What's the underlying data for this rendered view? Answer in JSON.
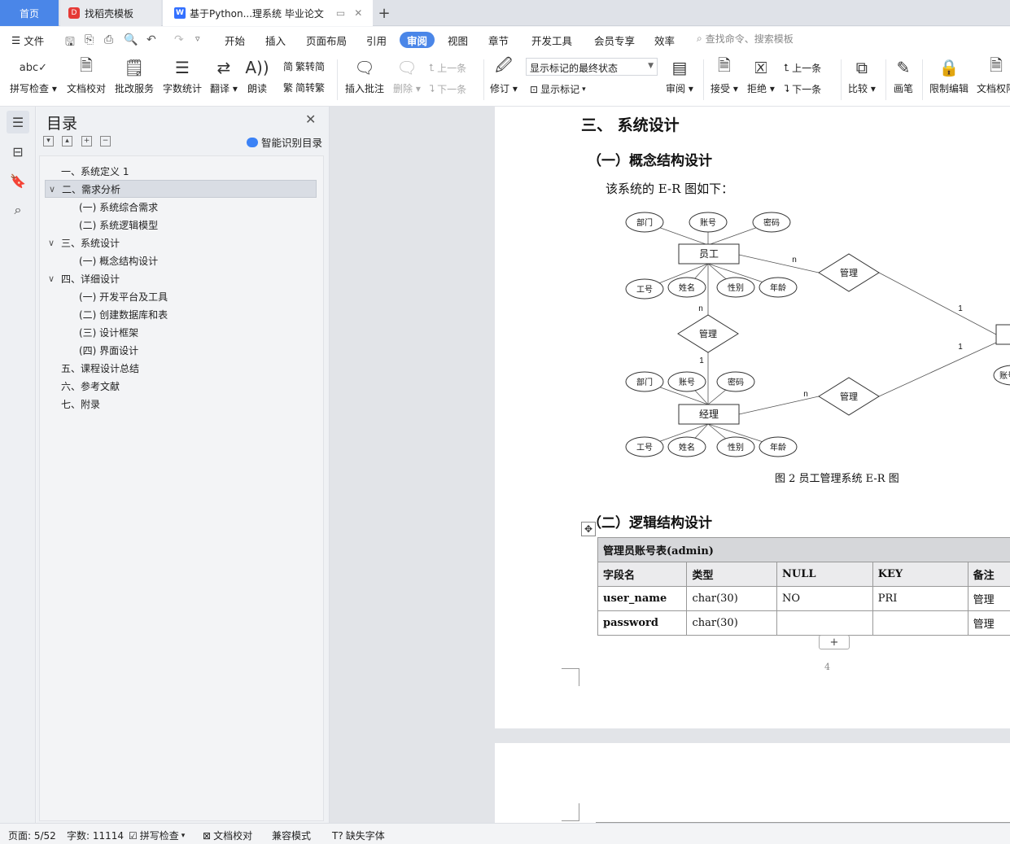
{
  "tabs": {
    "home": "首页",
    "templates": "找稻壳模板",
    "document": "基于Python...理系统 毕业论文",
    "new_tab": "+"
  },
  "menu": {
    "file": "文件",
    "items": [
      "开始",
      "插入",
      "页面布局",
      "引用",
      "审阅",
      "视图",
      "章节",
      "开发工具",
      "会员专享",
      "效率"
    ],
    "active": "审阅",
    "search_placeholder": "查找命令、搜索模板"
  },
  "ribbon": {
    "spell_check": "拼写检查",
    "doc_proof": "文档校对",
    "correct_service": "批改服务",
    "word_count": "字数统计",
    "translate": "翻译",
    "read_aloud": "朗读",
    "to_simplified": "繁转简",
    "to_traditional": "简转繁",
    "insert_comment": "插入批注",
    "delete": "删除",
    "prev_comment": "上一条",
    "next_comment": "下一条",
    "revise": "修订",
    "markup_state": "显示标记的最终状态",
    "show_markup": "显示标记",
    "review": "审阅",
    "accept": "接受",
    "reject": "拒绝",
    "prev_change": "上一条",
    "next_change": "下一条",
    "compare": "比较",
    "pen": "画笔",
    "restrict_edit": "限制编辑",
    "doc_permission": "文档权限"
  },
  "toc": {
    "title": "目录",
    "smart": "智能识别目录",
    "items": [
      {
        "label": "一、系统定义 1"
      },
      {
        "label": "二、需求分析"
      },
      {
        "label": "(一) 系统综合需求"
      },
      {
        "label": "(二) 系统逻辑模型"
      },
      {
        "label": "三、系统设计"
      },
      {
        "label": "(一) 概念结构设计"
      },
      {
        "label": "四、详细设计"
      },
      {
        "label": "(一) 开发平台及工具"
      },
      {
        "label": "(二) 创建数据库和表"
      },
      {
        "label": "(三) 设计框架"
      },
      {
        "label": "(四) 界面设计"
      },
      {
        "label": "五、课程设计总结"
      },
      {
        "label": "六、参考文献"
      },
      {
        "label": "七、附录"
      }
    ]
  },
  "document": {
    "heading_3": "三、 系统设计",
    "heading_concept": "（一）概念结构设计",
    "intro": "该系统的 E-R 图如下：",
    "caption": "图 2  员工管理系统 E-R 图",
    "heading_logic": "（二）逻辑结构设计",
    "page_number": "4",
    "er": {
      "employee": "员工",
      "manager": "经理",
      "manage": "管理",
      "attrs_top": [
        "部门",
        "账号",
        "密码"
      ],
      "attrs_bottom": [
        "工号",
        "姓名",
        "性别",
        "年龄"
      ],
      "n": "n",
      "one": "1",
      "cut_attr": "账号"
    },
    "table": {
      "caption": "管理员账号表(admin)",
      "headers": [
        "字段名",
        "类型",
        "NULL",
        "KEY",
        "备注"
      ],
      "rows": [
        [
          "user_name",
          "char(30)",
          "NO",
          "PRI",
          "管理"
        ],
        [
          "password",
          "char(30)",
          "",
          "",
          "管理"
        ]
      ]
    }
  },
  "status": {
    "page": "页面: 5/52",
    "words": "字数: 11114",
    "spell": "拼写检查",
    "proof": "文档校对",
    "compat": "兼容模式",
    "missing_font": "缺失字体"
  }
}
